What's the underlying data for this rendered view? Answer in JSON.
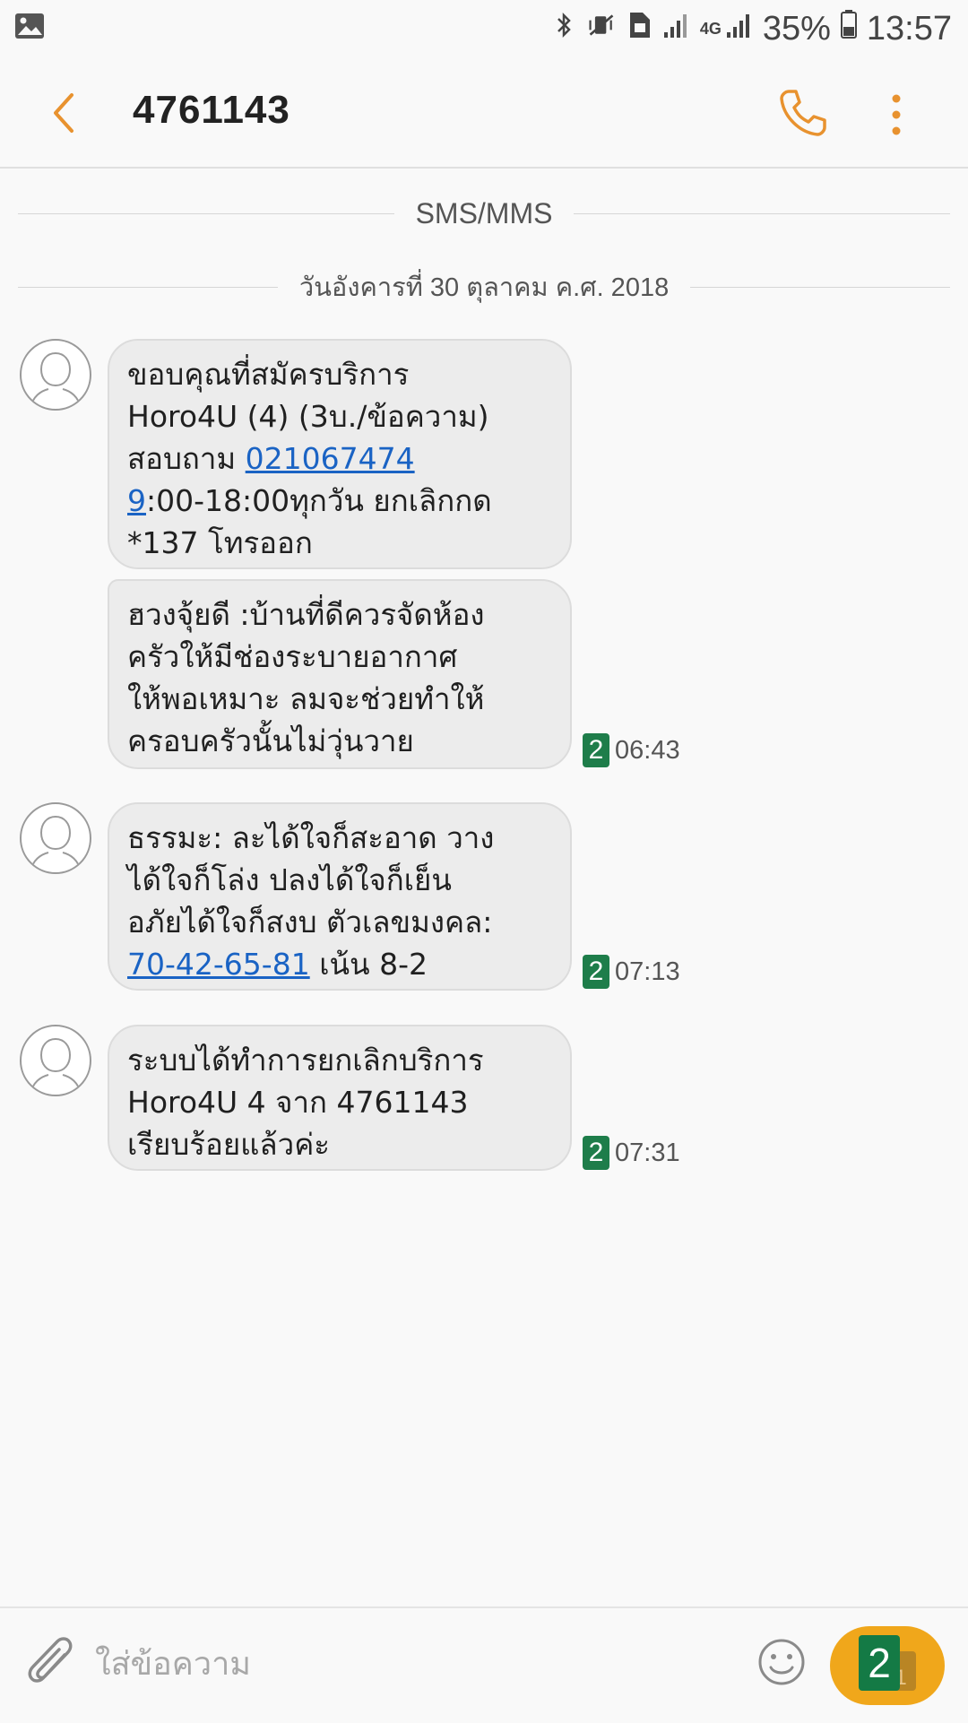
{
  "status_bar": {
    "battery_percent": "35%",
    "time": "13:57",
    "network_label": "4G",
    "icons": [
      "gallery-icon",
      "bluetooth-icon",
      "mute-vibrate-icon",
      "sim-icon",
      "signal-icon",
      "battery-icon"
    ]
  },
  "header": {
    "title": "4761143",
    "accent_color": "#e8922f"
  },
  "conversation": {
    "type_label": "SMS/MMS",
    "date_label": "วันอังคารที่ 30 ตุลาคม ค.ศ. 2018",
    "messages": [
      {
        "parts": [
          "ขอบคุณที่สมัครบริการ",
          "Horo4U (4) (3บ./ข้อความ)",
          "สอบถาม ",
          "021067474",
          "9",
          ":00-18:00ทุกวัน ยกเลิกกด",
          "*137 โทรออก"
        ]
      },
      {
        "parts": [
          "ฮวงจุ้ยดี :บ้านที่ดีควรจัดห้อง",
          "ครัวให้มีช่องระบายอากาศ",
          "ให้พอเหมาะ ลมจะช่วยทำให้",
          "ครอบครัวนั้นไม่วุ่นวาย"
        ],
        "sim": "2",
        "time": "06:43"
      },
      {
        "parts": [
          "ธรรมะ: ละได้ใจก็สะอาด วาง",
          "ได้ใจก็โล่ง ปลงได้ใจก็เย็น",
          "อภัยได้ใจก็สงบ ตัวเลขมงคล:",
          "70-42-65-81",
          " เน้น 8-2"
        ],
        "sim": "2",
        "time": "07:13"
      },
      {
        "parts": [
          "ระบบได้ทำการยกเลิกบริการ",
          "Horo4U 4 จาก 4761143",
          "เรียบร้อยแล้วค่ะ"
        ],
        "sim": "2",
        "time": "07:31"
      }
    ]
  },
  "composer": {
    "placeholder": "ใส่ข้อความ",
    "send_sim_primary": "2",
    "send_sim_secondary": "1",
    "send_color": "#f0a71b"
  }
}
